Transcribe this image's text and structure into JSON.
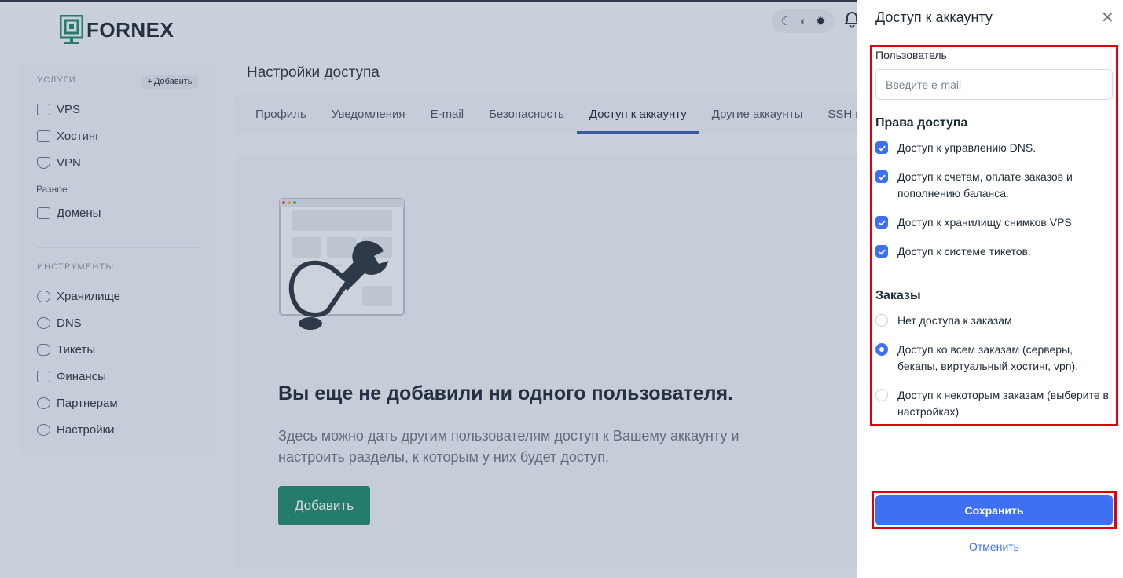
{
  "brand": {
    "name": "FORNEX",
    "color": "#1f8a6b"
  },
  "sidebar": {
    "services_label": "УСЛУГИ",
    "add_label": "Добавить",
    "services": [
      {
        "label": "VPS",
        "icon": "server-icon"
      },
      {
        "label": "Хостинг",
        "icon": "window-icon"
      },
      {
        "label": "VPN",
        "icon": "shield-icon"
      }
    ],
    "misc_label": "Разное",
    "misc": [
      {
        "label": "Домены",
        "icon": "domain-icon"
      }
    ],
    "tools_label": "ИНСТРУМЕНТЫ",
    "tools": [
      {
        "label": "Хранилище",
        "icon": "cloud-icon"
      },
      {
        "label": "DNS",
        "icon": "globe-icon"
      },
      {
        "label": "Тикеты",
        "icon": "chat-icon"
      },
      {
        "label": "Финансы",
        "icon": "card-icon"
      },
      {
        "label": "Партнерам",
        "icon": "users-icon"
      },
      {
        "label": "Настройки",
        "icon": "gear-icon"
      }
    ]
  },
  "main": {
    "title": "Настройки доступа",
    "tabs": [
      "Профиль",
      "Уведомления",
      "E-mail",
      "Безопасность",
      "Доступ к аккаунту",
      "Другие аккаунты",
      "SSH к"
    ],
    "active_tab": "Доступ к аккаунту",
    "empty_title": "Вы еще не добавили ни одного пользователя.",
    "empty_text": "Здесь можно дать другим пользователям доступ к Вашему аккаунту и настроить разделы, к которым у них будет доступ.",
    "add_button": "Добавить"
  },
  "panel": {
    "title": "Доступ к аккаунту",
    "user_label": "Пользователь",
    "email_placeholder": "Введите e-mail",
    "email_value": "",
    "rights_title": "Права доступа",
    "rights": [
      {
        "label": "Доступ к управлению DNS.",
        "checked": true
      },
      {
        "label": "Доступ к счетам, оплате заказов и пополнению баланса.",
        "checked": true
      },
      {
        "label": "Доступ к хранилищу снимков VPS",
        "checked": true
      },
      {
        "label": "Доступ к системе тикетов.",
        "checked": true
      }
    ],
    "orders_title": "Заказы",
    "orders": [
      {
        "label": "Нет доступа к заказам",
        "selected": false
      },
      {
        "label": "Доступ ко всем заказам (серверы, бекапы, виртуальный хостинг, vpn).",
        "selected": true
      },
      {
        "label": "Доступ к некоторым заказам (выберите в настройках)",
        "selected": false
      }
    ],
    "save_label": "Сохранить",
    "cancel_label": "Отменить",
    "accent_color": "#3f6ff2",
    "highlight_color": "#e0000a"
  }
}
